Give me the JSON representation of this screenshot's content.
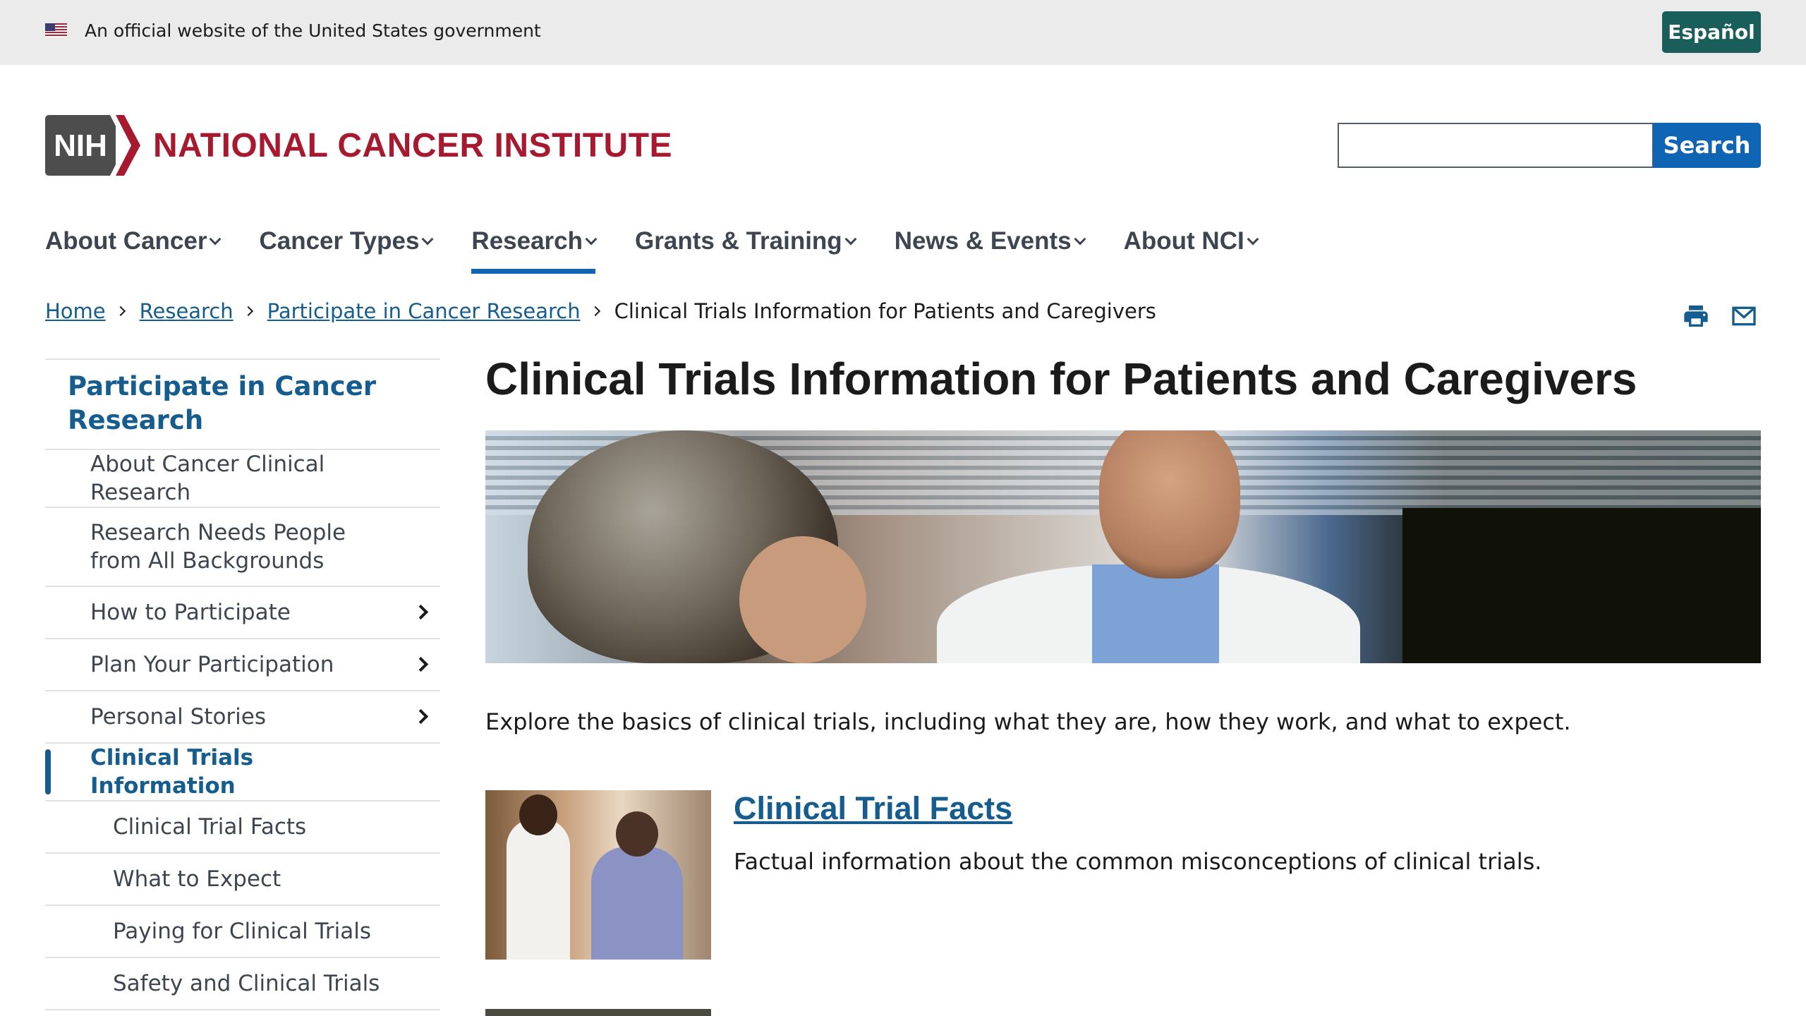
{
  "gov_banner": {
    "text": "An official website of the United States government",
    "language_button": "Español"
  },
  "header": {
    "logo_badge": "NIH",
    "logo_text": "NATIONAL CANCER INSTITUTE",
    "search": {
      "placeholder": "",
      "button_label": "Search"
    }
  },
  "main_nav": {
    "items": [
      {
        "label": "About Cancer"
      },
      {
        "label": "Cancer Types"
      },
      {
        "label": "Research",
        "active": true
      },
      {
        "label": "Grants & Training"
      },
      {
        "label": "News & Events"
      },
      {
        "label": "About NCI"
      }
    ]
  },
  "breadcrumb": {
    "items": [
      "Home",
      "Research",
      "Participate in Cancer Research"
    ],
    "current": "Clinical Trials Information for Patients and Caregivers"
  },
  "page_tools": {
    "print_icon": "print-icon",
    "email_icon": "email-icon"
  },
  "side_nav": {
    "heading": "Participate in Cancer Research",
    "items": [
      {
        "label": "About Cancer Clinical Research"
      },
      {
        "label": "Research Needs People from All Backgrounds"
      },
      {
        "label": "How to Participate",
        "expandable": true
      },
      {
        "label": "Plan Your Participation",
        "expandable": true
      },
      {
        "label": "Personal Stories",
        "expandable": true
      },
      {
        "label": "Clinical Trials Information",
        "current": true
      },
      {
        "label": "Clinical Trial Facts",
        "sub": true
      },
      {
        "label": "What to Expect",
        "sub": true
      },
      {
        "label": "Paying for Clinical Trials",
        "sub": true
      },
      {
        "label": "Safety and Clinical Trials",
        "sub": true
      }
    ]
  },
  "main": {
    "title": "Clinical Trials Information for Patients and Caregivers",
    "intro": "Explore the basics of clinical trials, including what they are, how they work, and what to expect.",
    "cards": [
      {
        "title": "Clinical Trial Facts",
        "description": "Factual information about the common misconceptions of clinical trials."
      }
    ]
  },
  "colors": {
    "brand_red": "#a6192e",
    "link_blue": "#155c8f",
    "search_blue": "#0f64b4",
    "espanol_teal": "#1a5e5c"
  }
}
